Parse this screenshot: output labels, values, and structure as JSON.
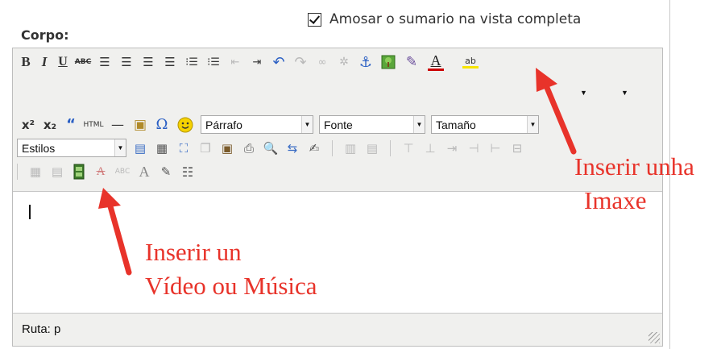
{
  "summary": {
    "label": "Amosar o sumario na vista completa",
    "checked": true
  },
  "field_label": "Corpo:",
  "toolbar": {
    "row1": [
      "bold-icon",
      "italic-icon",
      "underline-icon",
      "strikethrough-icon",
      "align-left-icon",
      "align-center-icon",
      "align-right-icon",
      "align-justify-icon",
      "bullet-list-icon",
      "numbered-list-icon",
      "outdent-icon",
      "indent-icon",
      "undo-icon",
      "redo-icon",
      "link-icon",
      "unlink-icon",
      "anchor-icon",
      "insert-image-icon",
      "cleanup-icon",
      "font-color-icon",
      "highlight-color-icon"
    ],
    "row2": [
      "superscript-icon",
      "subscript-icon",
      "blockquote-icon",
      "html-source-icon",
      "horizontal-rule-icon",
      "paste-icon",
      "special-character-icon",
      "emoticon-icon"
    ],
    "format_select": "Párrafo",
    "font_select": "Fonte",
    "size_select": "Tamaño",
    "styles_select": "Estilos",
    "html_label": "HTML",
    "abc_label": "ABC"
  },
  "status": {
    "path_label": "Ruta: p"
  },
  "annotations": {
    "image": {
      "line1": "Inserir unha",
      "line2": "Imaxe"
    },
    "media": {
      "line1": "Inserir un",
      "line2": "Vídeo ou Música"
    }
  },
  "colors": {
    "annotation": "#e8332a",
    "toolbar_bg": "#f0f0ee",
    "border": "#bdbdbd",
    "font_color_bar": "#cc0000",
    "highlight_bar": "#f7e400"
  }
}
